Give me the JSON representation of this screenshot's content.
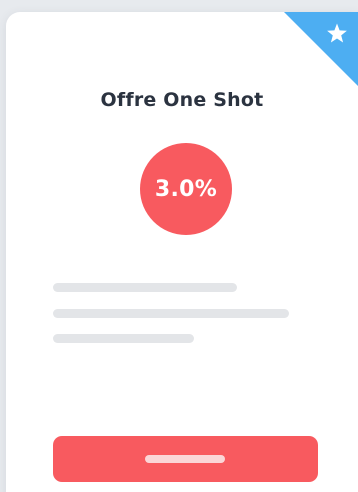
{
  "offer": {
    "title": "Offre One Shot",
    "rate": "3.0%"
  },
  "badge": {
    "icon": "star-icon",
    "color": "#4daef2"
  },
  "colors": {
    "accent": "#f85a5f",
    "title_text": "#2b3340",
    "background": "#e7eaee",
    "card": "#ffffff",
    "skeleton": "#e3e5e8"
  }
}
